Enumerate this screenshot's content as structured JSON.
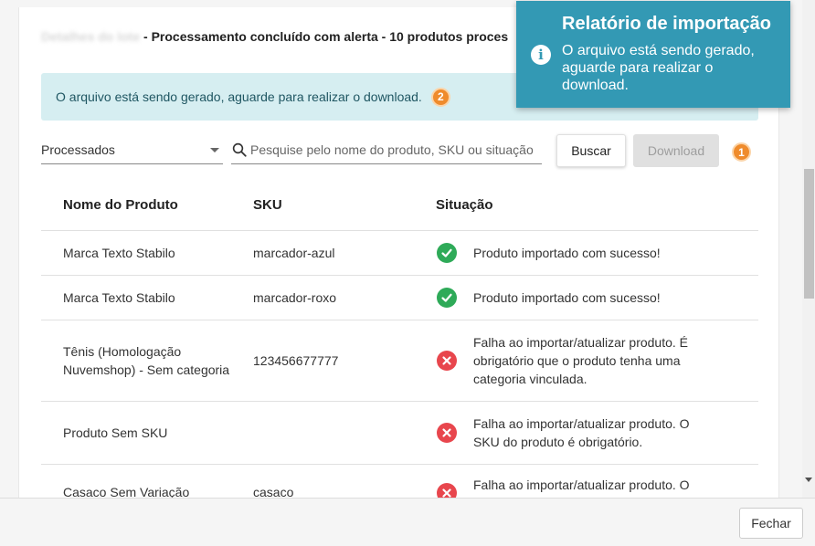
{
  "header": {
    "blurred_prefix": "Detalhes do lote",
    "summary": "- Processamento concluído com alerta - 10 produtos proces"
  },
  "alert": {
    "message": "O arquivo está sendo gerado, aguarde para realizar o download.",
    "badge": "2"
  },
  "filters": {
    "select_value": "Processados",
    "search_placeholder": "Pesquise pelo nome do produto, SKU ou situação",
    "search_label": "Buscar",
    "download_label": "Download",
    "download_badge": "1"
  },
  "table": {
    "columns": [
      "Nome do Produto",
      "SKU",
      "Situação"
    ],
    "rows": [
      {
        "name": "Marca Texto Stabilo",
        "sku": "marcador-azul",
        "status": "success",
        "message": "Produto importado com sucesso!"
      },
      {
        "name": "Marca Texto Stabilo",
        "sku": "marcador-roxo",
        "status": "success",
        "message": "Produto importado com sucesso!"
      },
      {
        "name": "Tênis (Homologação Nuvemshop) - Sem categoria",
        "sku": "123456677777",
        "status": "error",
        "message": "Falha ao importar/atualizar produto. É obrigatório que o produto tenha uma categoria vinculada."
      },
      {
        "name": "Produto Sem SKU",
        "sku": "",
        "status": "error",
        "message": "Falha ao importar/atualizar produto. O SKU do produto é obrigatório."
      },
      {
        "name": "Casaco Sem Variação",
        "sku": "casaco",
        "status": "error",
        "message": "Falha ao importar/atualizar produto. O"
      }
    ]
  },
  "toast": {
    "title": "Relatório de importação",
    "message": "O arquivo está sendo gerado, aguarde para realizar o download.",
    "icon": "info-icon",
    "color": "#3399b4"
  },
  "footer": {
    "close_label": "Fechar"
  },
  "colors": {
    "success": "#2eaa58",
    "error": "#e8464d",
    "badge": "#ef8b2c",
    "alert_bg": "#d6eef1"
  }
}
